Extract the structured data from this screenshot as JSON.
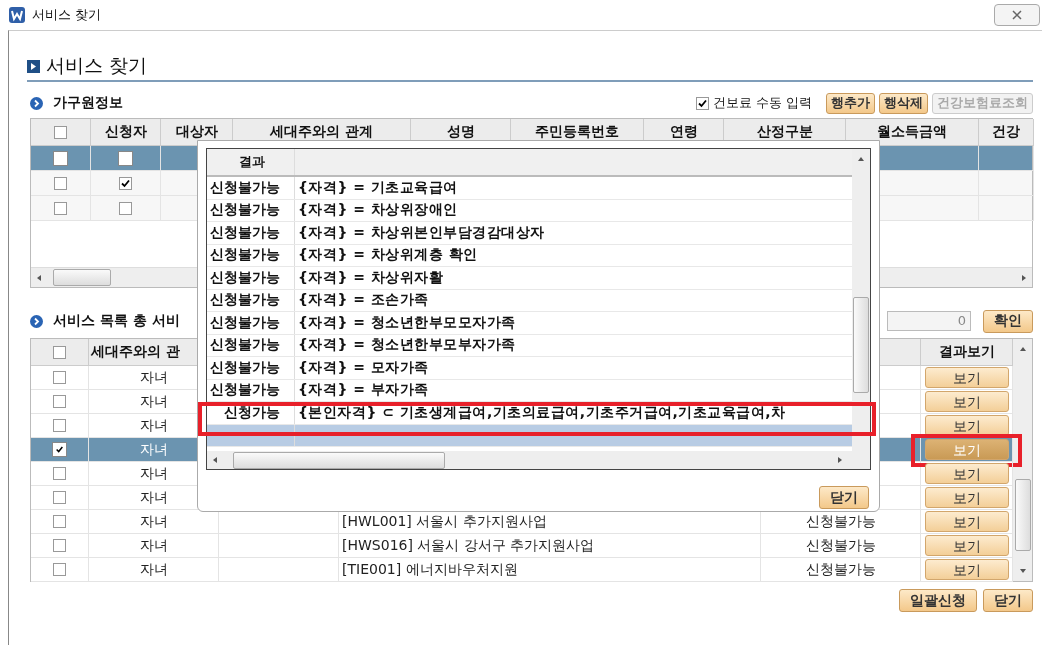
{
  "window": {
    "title": "서비스 찾기"
  },
  "heading": "서비스 찾기",
  "household": {
    "title": "가구원정보",
    "manual_input": {
      "label": "건보료 수동 입력",
      "checked": true
    },
    "buttons": [
      {
        "label": "행추가",
        "disabled": false
      },
      {
        "label": "행삭제",
        "disabled": false
      },
      {
        "label": "건강보험료조회",
        "disabled": true
      }
    ],
    "table": {
      "header_checked": false,
      "columns": [
        "신청자",
        "대상자",
        "세대주와의 관계",
        "성명",
        "주민등록번호",
        "연령",
        "산정구분",
        "월소득금액",
        "건강"
      ],
      "rows": [
        {
          "selected": true,
          "checked": false,
          "applicant": false
        },
        {
          "selected": false,
          "checked": false,
          "applicant": true
        },
        {
          "selected": false,
          "checked": false,
          "applicant": false
        }
      ]
    }
  },
  "services": {
    "title": "서비스 목록 총 서비",
    "count": "0",
    "confirm": "확인",
    "table": {
      "header_checked": false,
      "columns": {
        "relation": "세대주와의 관",
        "result": "결과보기"
      },
      "rows": [
        {
          "checked": false,
          "selected": false,
          "highlighted": false,
          "relation": "자녀",
          "button": "보기"
        },
        {
          "checked": false,
          "selected": false,
          "highlighted": false,
          "relation": "자녀",
          "button": "보기"
        },
        {
          "checked": false,
          "selected": false,
          "highlighted": false,
          "relation": "자녀",
          "button": "보기"
        },
        {
          "checked": true,
          "selected": true,
          "highlighted": true,
          "relation": "자녀",
          "button": "보기"
        },
        {
          "checked": false,
          "selected": false,
          "highlighted": false,
          "relation": "자녀",
          "button": "보기"
        },
        {
          "checked": false,
          "selected": false,
          "highlighted": false,
          "relation": "자녀",
          "button": "보기"
        },
        {
          "checked": false,
          "selected": false,
          "highlighted": false,
          "relation": "자녀",
          "service": "[HWL001] 서울시 추가지원사업",
          "status": "신청불가능",
          "button": "보기"
        },
        {
          "checked": false,
          "selected": false,
          "highlighted": false,
          "relation": "자녀",
          "service": "[HWS016] 서울시 강서구 추가지원사업",
          "status": "신청불가능",
          "button": "보기"
        },
        {
          "checked": false,
          "selected": false,
          "highlighted": false,
          "relation": "자녀",
          "service": "[TIE001] 에너지바우처지원",
          "status": "신청불가능",
          "button": "보기"
        }
      ]
    }
  },
  "footer_buttons": [
    "일괄신청",
    "닫기"
  ],
  "popup": {
    "columns": [
      "결과"
    ],
    "close": "닫기",
    "rows": [
      {
        "result": "신청불가능",
        "condition": "{자격} = 기초교육급여",
        "selected": false,
        "highlighted": false
      },
      {
        "result": "신청불가능",
        "condition": "{자격} = 차상위장애인",
        "selected": false,
        "highlighted": false
      },
      {
        "result": "신청불가능",
        "condition": "{자격} = 차상위본인부담경감대상자",
        "selected": false,
        "highlighted": false
      },
      {
        "result": "신청불가능",
        "condition": "{자격} = 차상위계층 확인",
        "selected": false,
        "highlighted": false
      },
      {
        "result": "신청불가능",
        "condition": "{자격} = 차상위자활",
        "selected": false,
        "highlighted": false
      },
      {
        "result": "신청불가능",
        "condition": "{자격} = 조손가족",
        "selected": false,
        "highlighted": false
      },
      {
        "result": "신청불가능",
        "condition": "{자격} = 청소년한부모모자가족",
        "selected": false,
        "highlighted": false
      },
      {
        "result": "신청불가능",
        "condition": "{자격} = 청소년한부모부자가족",
        "selected": false,
        "highlighted": false
      },
      {
        "result": "신청불가능",
        "condition": "{자격} = 모자가족",
        "selected": false,
        "highlighted": false
      },
      {
        "result": "신청불가능",
        "condition": "{자격} = 부자가족",
        "selected": false,
        "highlighted": false
      },
      {
        "result": "신청가능",
        "condition": "{본인자격} ⊂ 기초생계급여,기초의료급여,기초주거급여,기초교육급여,차",
        "selected": false,
        "highlighted": true
      },
      {
        "selected": true,
        "highlighted": false
      }
    ]
  }
}
